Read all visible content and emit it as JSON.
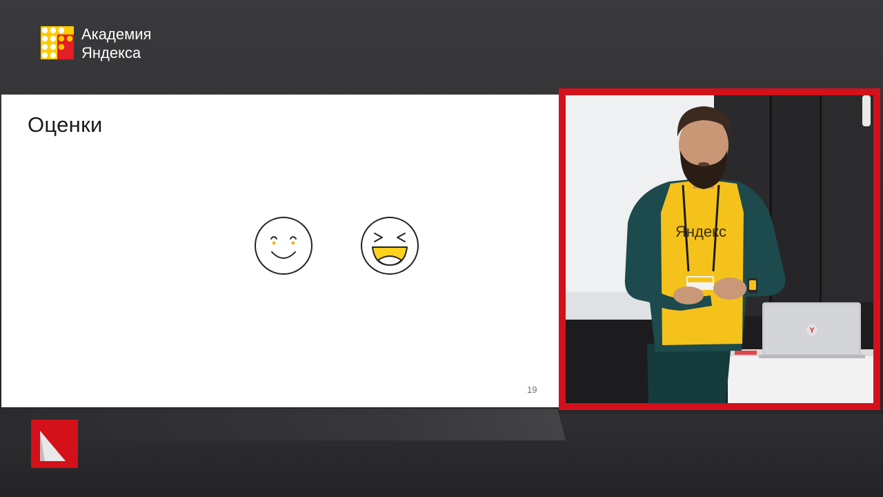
{
  "brand": {
    "line1": "Академия",
    "line2": "Яндекса",
    "colors": {
      "yellow": "#ffcc00",
      "red": "#e31e24"
    }
  },
  "slide": {
    "title": "Оценки",
    "page_number": "19",
    "icons": [
      "smiling-face-icon",
      "laughing-face-icon"
    ]
  },
  "video": {
    "shirt_text": "Яндекс",
    "laptop_logo": "Y",
    "frame_color": "#d4101a"
  }
}
